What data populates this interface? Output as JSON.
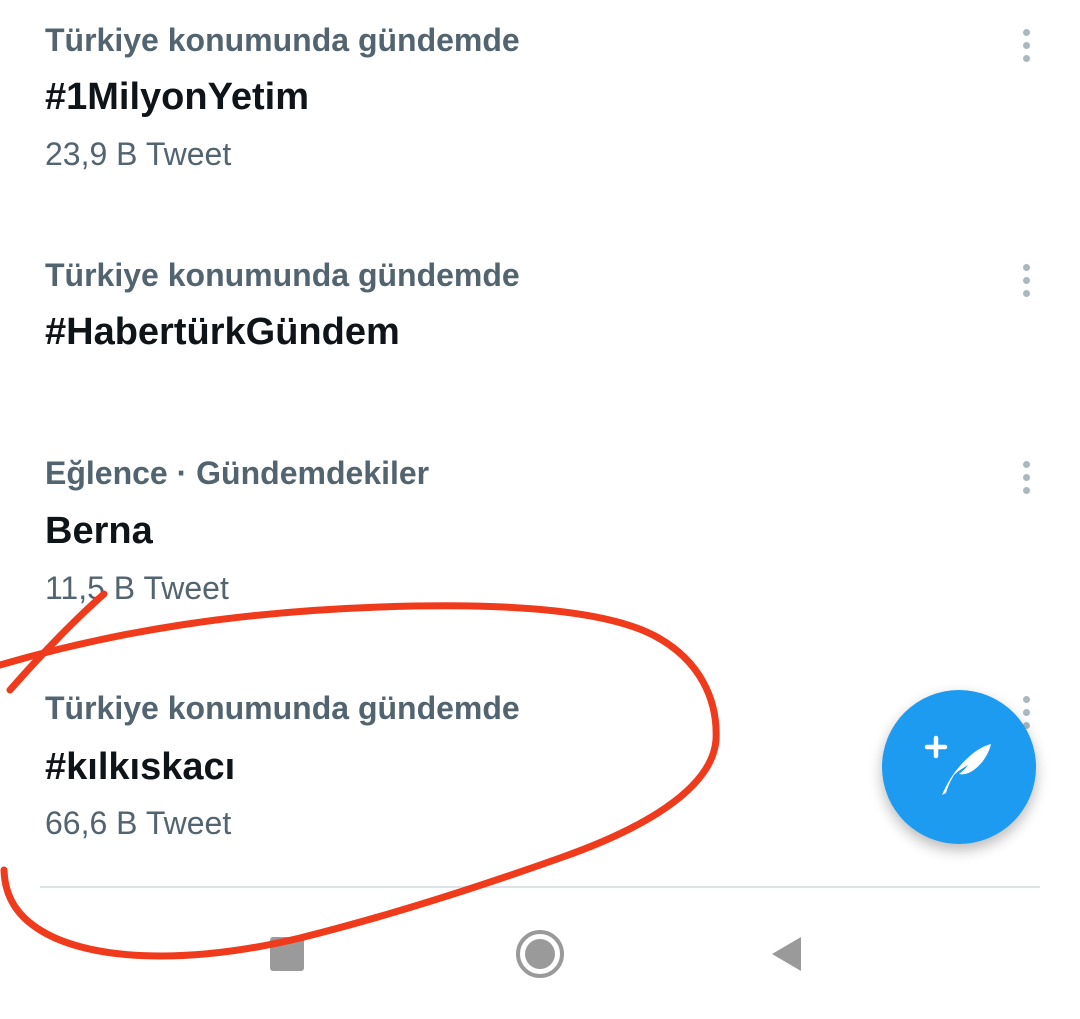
{
  "trends": [
    {
      "context": "Türkiye konumunda gündemde",
      "topic": "#1MilyonYetim",
      "count": "23,9 B Tweet"
    },
    {
      "context": "Türkiye konumunda gündemde",
      "topic": "#HabertürkGündem",
      "count": ""
    },
    {
      "context": "Eğlence · Gündemdekiler",
      "topic": "Berna",
      "count": "11,5 B Tweet"
    },
    {
      "context": "Türkiye konumunda gündemde",
      "topic": "#kılkıskacı",
      "count": "66,6 B Tweet"
    }
  ],
  "icons": {
    "more": "more-vertical-icon",
    "compose": "compose-tweet-icon",
    "nav_recents": "recents-icon",
    "nav_home": "home-icon",
    "nav_back": "back-icon"
  },
  "colors": {
    "accent": "#1d9bf0",
    "annotation": "#f03a1c",
    "secondary_text": "#536471",
    "primary_text": "#0f1419"
  }
}
